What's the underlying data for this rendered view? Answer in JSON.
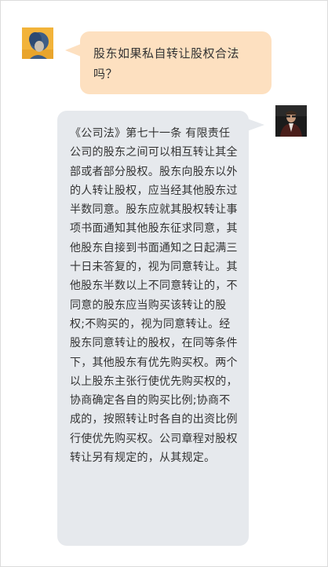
{
  "conversation": {
    "user": {
      "avatar_icon": "user-avatar-portrait",
      "question": "股东如果私自转让股权合法吗？"
    },
    "assistant": {
      "avatar_icon": "lawyer-avatar-portrait",
      "answer": "《公司法》第七十一条 有限责任公司的股东之间可以相互转让其全部或者部分股权。股东向股东以外的人转让股权，应当经其他股东过半数同意。股东应就其股权转让事项书面通知其他股东征求同意，其他股东自接到书面通知之日起满三十日未答复的，视为同意转让。其他股东半数以上不同意转让的，不同意的股东应当购买该转让的股权;不购买的，视为同意转让。经股东同意转让的股权，在同等条件下，其他股东有优先购买权。两个以上股东主张行使优先购买权的，协商确定各自的购买比例;协商不成的，按照转让时各自的出资比例行使优先购买权。公司章程对股权转让另有规定的，从其规定。"
    }
  },
  "colors": {
    "question_bubble": "#fde0c0",
    "answer_bubble": "#e6e9ed",
    "text": "#333333"
  }
}
